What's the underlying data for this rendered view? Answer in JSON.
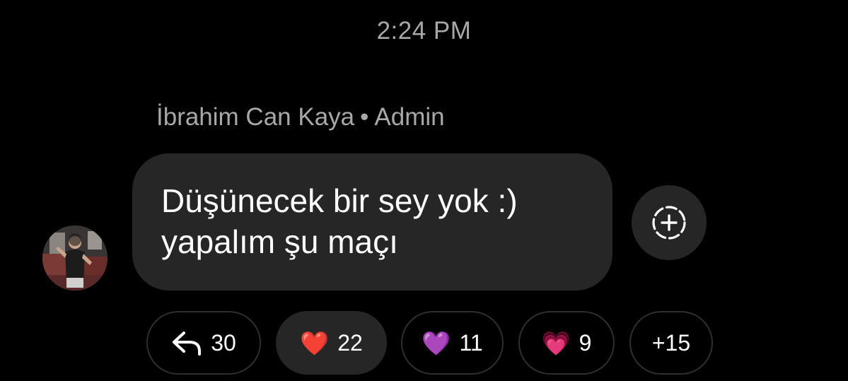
{
  "timestamp": "2:24 PM",
  "message": {
    "sender_name": "İbrahim Can Kaya",
    "separator": "•",
    "sender_role": "Admin",
    "lines": [
      "Düşünecek bir sey yok :)",
      "yapalım şu maçı"
    ]
  },
  "avatar_icon": "profile-photo",
  "add_reaction_icon": "add-reaction-icon",
  "reactions": {
    "reply": {
      "icon": "reply-arrow-icon",
      "count": "30"
    },
    "red_heart": {
      "emoji": "❤️",
      "count": "22",
      "selected": true
    },
    "purple_heart": {
      "emoji": "💜",
      "count": "11"
    },
    "pink_heart": {
      "emoji": "💗",
      "count": "9"
    },
    "more": {
      "label": "+15"
    }
  },
  "colors": {
    "background": "#000000",
    "bubble": "#262626",
    "secondary_text": "#a8a8a8",
    "pill_border": "#2e2e2e"
  }
}
